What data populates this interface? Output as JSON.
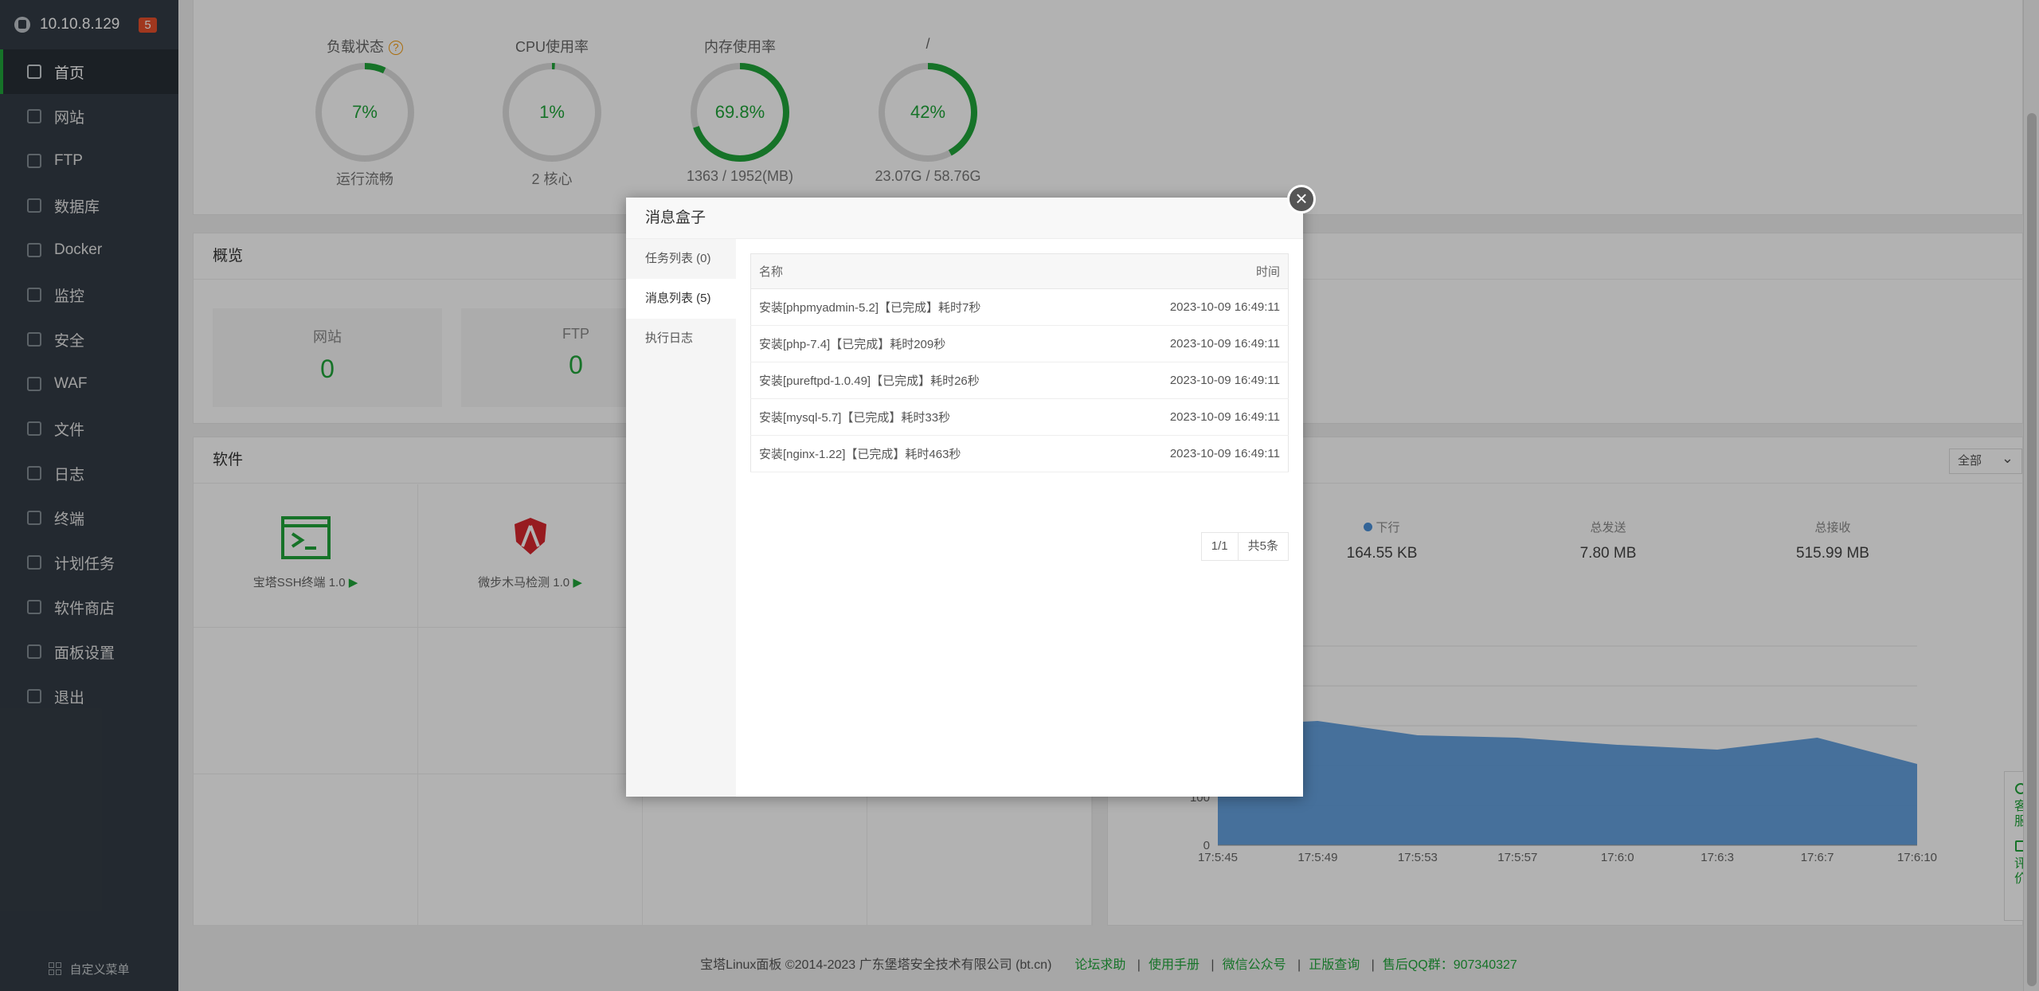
{
  "sidebar": {
    "server_ip": "10.10.8.129",
    "badge_count": "5",
    "items": [
      {
        "label": "首页",
        "icon": "home-icon"
      },
      {
        "label": "网站",
        "icon": "globe-icon"
      },
      {
        "label": "FTP",
        "icon": "ftp-icon"
      },
      {
        "label": "数据库",
        "icon": "database-icon"
      },
      {
        "label": "Docker",
        "icon": "docker-icon"
      },
      {
        "label": "监控",
        "icon": "monitor-icon"
      },
      {
        "label": "安全",
        "icon": "shield-icon"
      },
      {
        "label": "WAF",
        "icon": "waf-icon"
      },
      {
        "label": "文件",
        "icon": "folder-icon"
      },
      {
        "label": "日志",
        "icon": "log-icon"
      },
      {
        "label": "终端",
        "icon": "terminal-icon"
      },
      {
        "label": "计划任务",
        "icon": "calendar-icon"
      },
      {
        "label": "软件商店",
        "icon": "apps-icon"
      },
      {
        "label": "面板设置",
        "icon": "gear-icon"
      },
      {
        "label": "退出",
        "icon": "logout-icon"
      }
    ],
    "custom_menu": "自定义菜单"
  },
  "status": [
    {
      "label": "负载状态",
      "value": "7%",
      "percent": 7,
      "sub": "运行流畅",
      "help": "?"
    },
    {
      "label": "CPU使用率",
      "value": "1%",
      "percent": 1,
      "sub": "2 核心"
    },
    {
      "label": "内存使用率",
      "value": "69.8%",
      "percent": 69.8,
      "sub": "1363 / 1952(MB)"
    },
    {
      "label": "/",
      "value": "42%",
      "percent": 42,
      "sub": "23.07G / 58.76G"
    }
  ],
  "overview": {
    "title": "概览",
    "cards": [
      {
        "label": "网站",
        "value": "0"
      },
      {
        "label": "FTP",
        "value": "0"
      }
    ]
  },
  "software": {
    "title": "软件",
    "items": [
      {
        "name": "宝塔SSH终端 1.0",
        "arrow": "▶"
      },
      {
        "name": "微步木马检测 1.0",
        "arrow": "▶"
      }
    ]
  },
  "traffic": {
    "filter": "全部",
    "stats": [
      {
        "label": "下行",
        "value": "164.55 KB"
      },
      {
        "label": "总发送",
        "value": "7.80 MB"
      },
      {
        "label": "总接收",
        "value": "515.99 MB"
      }
    ]
  },
  "chart_data": {
    "type": "area",
    "x": [
      "17:5:45",
      "17:5:49",
      "17:5:53",
      "17:5:57",
      "17:6:0",
      "17:6:3",
      "17:6:7",
      "17:6:10"
    ],
    "series": [
      {
        "values": [
          250,
          260,
          230,
          225,
          210,
          200,
          225,
          170
        ]
      }
    ],
    "y_ticks": [
      "0",
      "100"
    ],
    "ylim": [
      0,
      500
    ]
  },
  "modal": {
    "title": "消息盒子",
    "close_glyph": "×",
    "tabs": [
      "任务列表 (0)",
      "消息列表 (5)",
      "执行日志"
    ],
    "table": {
      "headers": [
        "名称",
        "时间"
      ],
      "rows": [
        [
          "安装[phpmyadmin-5.2]【已完成】耗时7秒",
          "2023-10-09 16:49:11"
        ],
        [
          "安装[php-7.4]【已完成】耗时209秒",
          "2023-10-09 16:49:11"
        ],
        [
          "安装[pureftpd-1.0.49]【已完成】耗时26秒",
          "2023-10-09 16:49:11"
        ],
        [
          "安装[mysql-5.7]【已完成】耗时33秒",
          "2023-10-09 16:49:11"
        ],
        [
          "安装[nginx-1.22]【已完成】耗时463秒",
          "2023-10-09 16:49:11"
        ]
      ]
    },
    "pager": {
      "page": "1/1",
      "total": "共5条"
    }
  },
  "footer": {
    "copyright": "宝塔Linux面板 ©2014-2023 广东堡塔安全技术有限公司 (bt.cn)",
    "links": [
      "论坛求助",
      "使用手册",
      "微信公众号",
      "正版查询",
      "售后QQ群：907340327"
    ]
  },
  "float_tools": {
    "service": "客服",
    "review": "评价"
  },
  "colors": {
    "accent": "#20a53a",
    "sidebar": "#333c45",
    "chart_fill": "#4a90d9"
  }
}
